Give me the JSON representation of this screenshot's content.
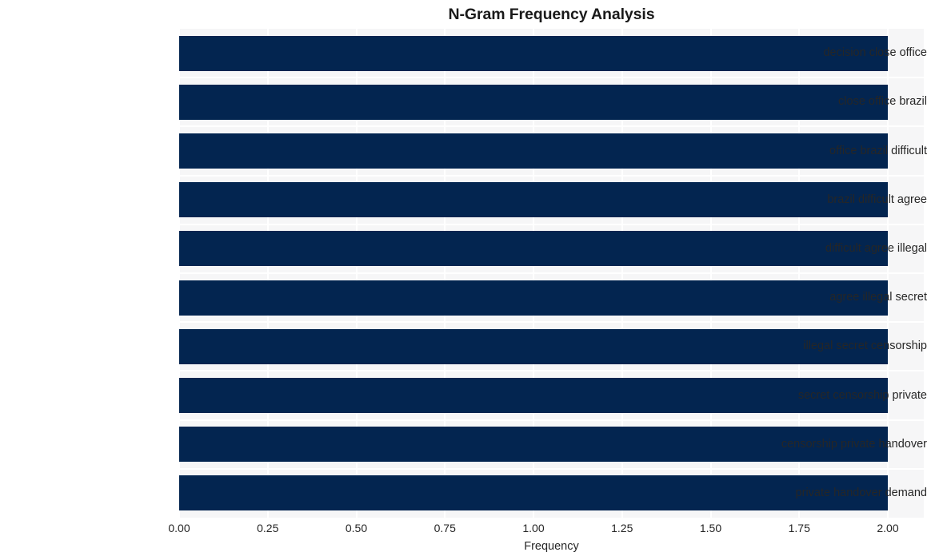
{
  "chart_data": {
    "type": "bar",
    "orientation": "horizontal",
    "title": "N-Gram Frequency Analysis",
    "xlabel": "Frequency",
    "ylabel": "",
    "categories": [
      "decision close office",
      "close office brazil",
      "office brazil difficult",
      "brazil difficult agree",
      "difficult agree illegal",
      "agree illegal secret",
      "illegal secret censorship",
      "secret censorship private",
      "censorship private handover",
      "private handover demand"
    ],
    "values": [
      2,
      2,
      2,
      2,
      2,
      2,
      2,
      2,
      2,
      2
    ],
    "xlim": [
      0.0,
      2.0
    ],
    "xticks": [
      "0.00",
      "0.25",
      "0.50",
      "0.75",
      "1.00",
      "1.25",
      "1.50",
      "1.75",
      "2.00"
    ],
    "xtick_values": [
      0.0,
      0.25,
      0.5,
      0.75,
      1.0,
      1.25,
      1.5,
      1.75,
      2.0
    ],
    "grid": true,
    "legend": false,
    "bar_color": "#032550",
    "plot_background": "#f6f6f7",
    "figure_background": "#ffffff",
    "gridline_color": "#ffffff",
    "text_color": "#262626"
  }
}
